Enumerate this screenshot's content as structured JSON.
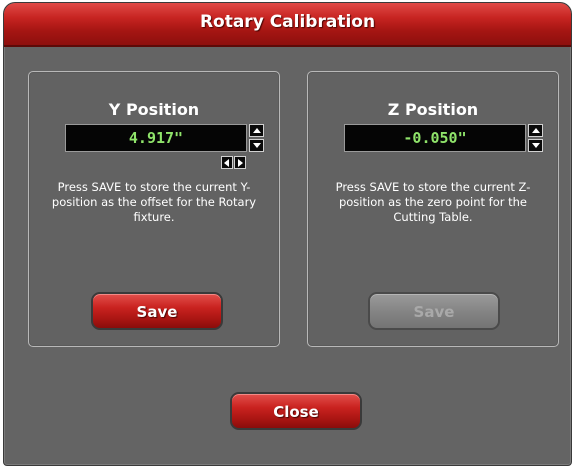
{
  "dialog": {
    "title": "Rotary Calibration"
  },
  "y_panel": {
    "title": "Y Position",
    "value": "4.917\"",
    "description": "Press SAVE to store the current Y-position as the offset for the Rotary fixture.",
    "save_label": "Save"
  },
  "z_panel": {
    "title": "Z Position",
    "value": "-0.050\"",
    "description": "Press SAVE to store the current Z-position as the zero point for the Cutting Table.",
    "save_label": "Save"
  },
  "close_label": "Close",
  "colors": {
    "title_bar": "#c72421",
    "background": "#646464",
    "lcd_text": "#8fe36a",
    "button_red": "#c9221f",
    "button_disabled": "#858585"
  }
}
